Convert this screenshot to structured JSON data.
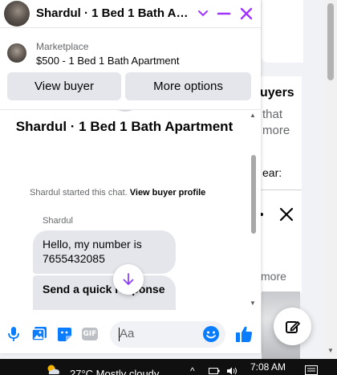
{
  "header": {
    "title": "Shardul · 1 Bed 1 Bath Apa...",
    "accent": "#a033ff"
  },
  "marketplace": {
    "label": "Marketplace",
    "listing": "$500 - 1 Bed 1 Bath Apartment"
  },
  "actions": {
    "view_buyer": "View buyer",
    "more_options": "More options"
  },
  "conversation": {
    "title": "Shardul · 1 Bed 1 Bath Apartment",
    "started_text": "Shardul started this chat.",
    "view_profile_link": "View buyer profile",
    "sender": "Shardul",
    "messages": [
      {
        "text": "Hello, my number is 7655432085"
      },
      {
        "text": "Send a quick response"
      }
    ]
  },
  "composer": {
    "placeholder": "Aa",
    "icons": [
      "microphone-icon",
      "photo-icon",
      "sticker-icon",
      "gif-icon",
      "emoji-icon",
      "like-icon"
    ],
    "gif_label": "GIF",
    "brand_color": "#0a7cff"
  },
  "background": {
    "heading": "uyers",
    "lines": [
      "that",
      "more"
    ],
    "label": "ear:",
    "more_link": "more"
  },
  "taskbar": {
    "weather": "27°C  Mostly cloudy",
    "time": "7:08 AM"
  }
}
